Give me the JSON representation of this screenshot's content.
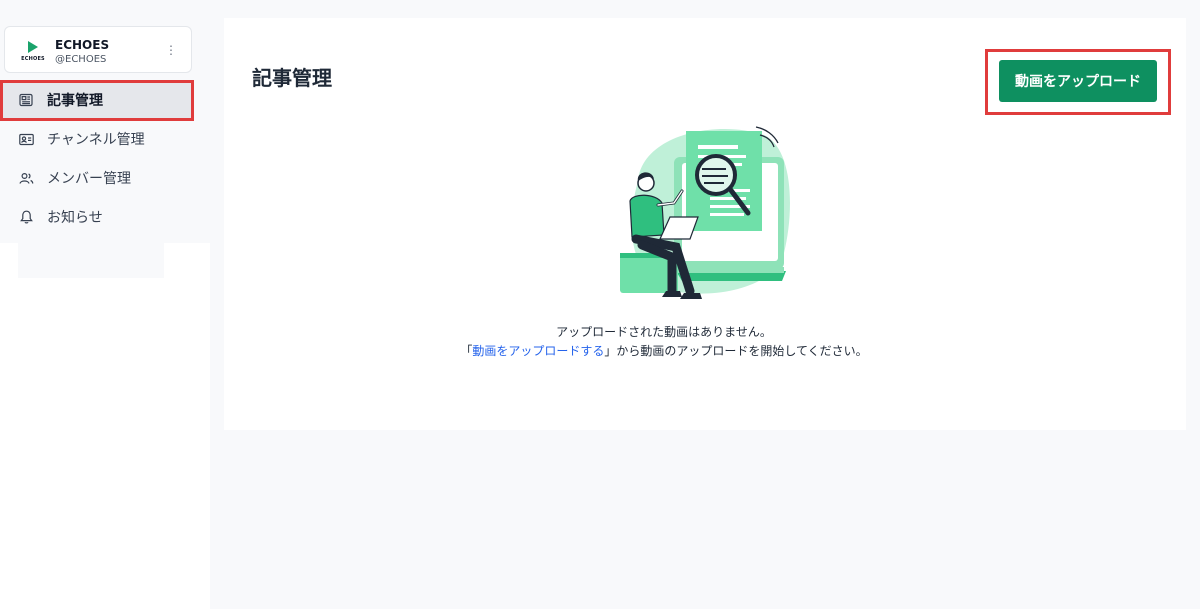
{
  "account": {
    "logo_text": "ECHOES",
    "name": "ECHOES",
    "handle": "@ECHOES",
    "menu_glyph": "⋮"
  },
  "sidebar": {
    "items": [
      {
        "label": "記事管理",
        "icon": "newspaper-icon",
        "active": true
      },
      {
        "label": "チャンネル管理",
        "icon": "id-card-icon",
        "active": false
      },
      {
        "label": "メンバー管理",
        "icon": "users-icon",
        "active": false
      },
      {
        "label": "お知らせ",
        "icon": "bell-icon",
        "active": false
      }
    ]
  },
  "main": {
    "title": "記事管理",
    "upload_button_label": "動画をアップロード",
    "empty_line1": "アップロードされた動画はありません。",
    "empty_line2_open": "「",
    "empty_line2_link": "動画をアップロードする",
    "empty_line2_rest": "」から動画のアップロードを開始してください。"
  },
  "colors": {
    "accent": "#0e9060",
    "highlight": "#e03c3c",
    "link": "#2563eb",
    "illustration_mint": "#bff0d8"
  }
}
